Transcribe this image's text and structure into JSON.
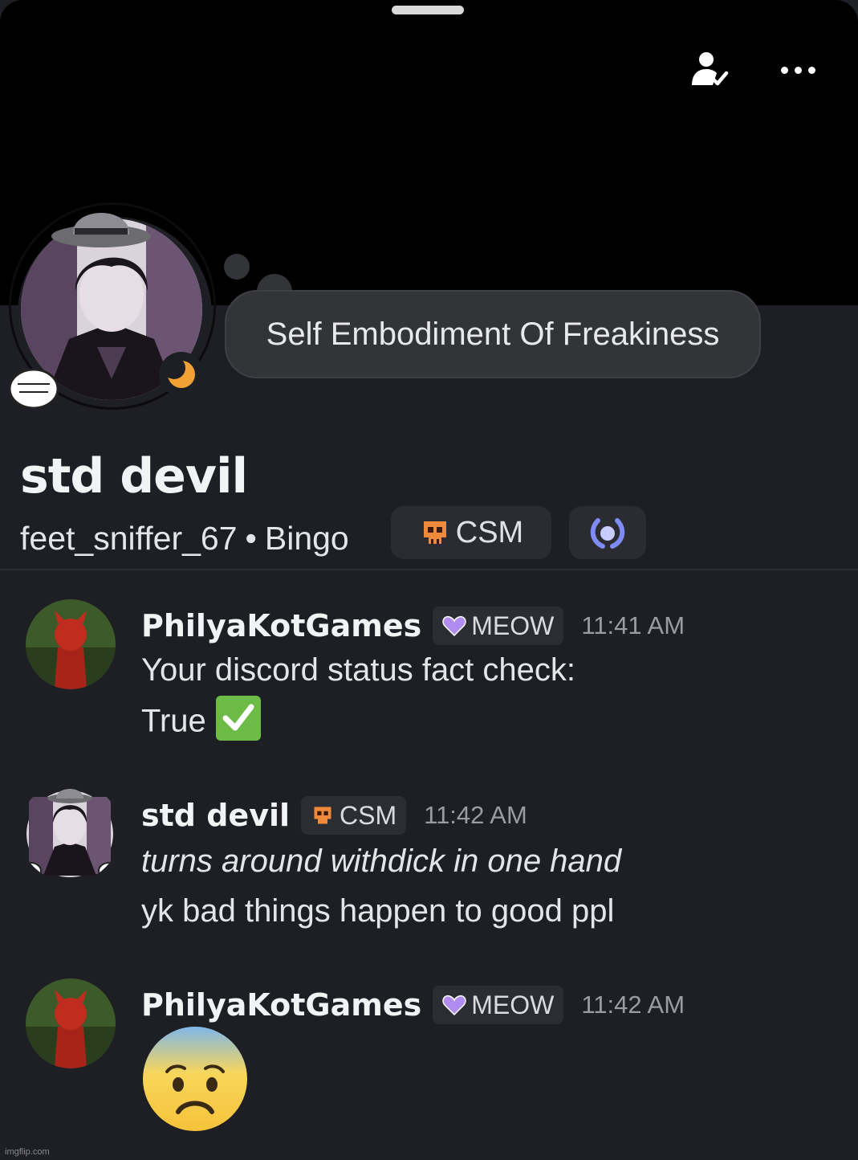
{
  "profile": {
    "custom_status": "Self Embodiment Of Freakiness",
    "display_name": "std devil",
    "username": "feet_sniffer_67",
    "separator": "•",
    "pronoun_or_tag": "Bingo",
    "clan_tag": "CSM",
    "status": "idle-moon"
  },
  "messages": [
    {
      "author": "PhilyaKotGames",
      "role_tag": "MEOW",
      "time": "11:41 AM",
      "lines": [
        "Your discord status fact check:",
        "True"
      ]
    },
    {
      "author": "std devil",
      "role_tag": "CSM",
      "time": "11:42 AM",
      "lines": [
        "turns around withdick in one hand",
        "yk bad things happen to good ppl"
      ]
    },
    {
      "author": "PhilyaKotGames",
      "role_tag": "MEOW",
      "time": "11:42 AM",
      "lines": []
    }
  ],
  "watermark": "imgflip.com",
  "colors": {
    "banner": "#000000",
    "background": "#1e1f24",
    "idle_moon": "#f0a232",
    "check_green": "#6dbb47",
    "heart_purple": "#b08cf0",
    "skull_orange": "#f08a3a"
  },
  "icons": {
    "friend": "add-friend-check-icon",
    "more": "more-options-icon"
  }
}
